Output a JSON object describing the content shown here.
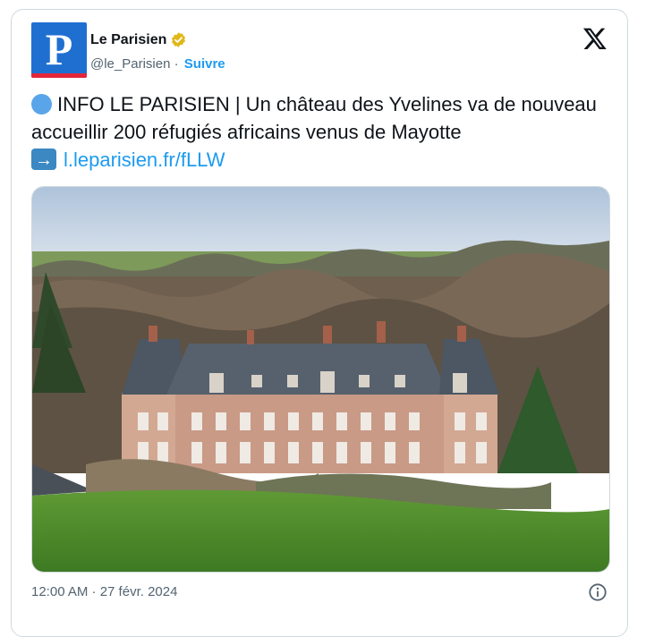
{
  "tweet": {
    "author_name": "Le Parisien",
    "author_handle": "@le_Parisien",
    "separator": "·",
    "follow_label": "Suivre",
    "avatar_letter": "P",
    "text_part1": "INFO LE PARISIEN | Un château des Yvelines va de nouveau accueillir 200 réfugiés africains venus de Mayotte",
    "link_text": "l.leparisien.fr/fLLW",
    "timestamp": "12:00 AM · 27 févr. 2024",
    "icons": {
      "verified": "verified-badge-icon",
      "x": "x-logo-icon",
      "info": "info-icon",
      "bullet": "blue-circle-emoji",
      "arrow": "right-arrow-emoji"
    },
    "colors": {
      "accent": "#1d9bf0",
      "avatar_bg": "#1f6fd1",
      "avatar_bar": "#e3263a",
      "verified": "#e2b719"
    }
  }
}
